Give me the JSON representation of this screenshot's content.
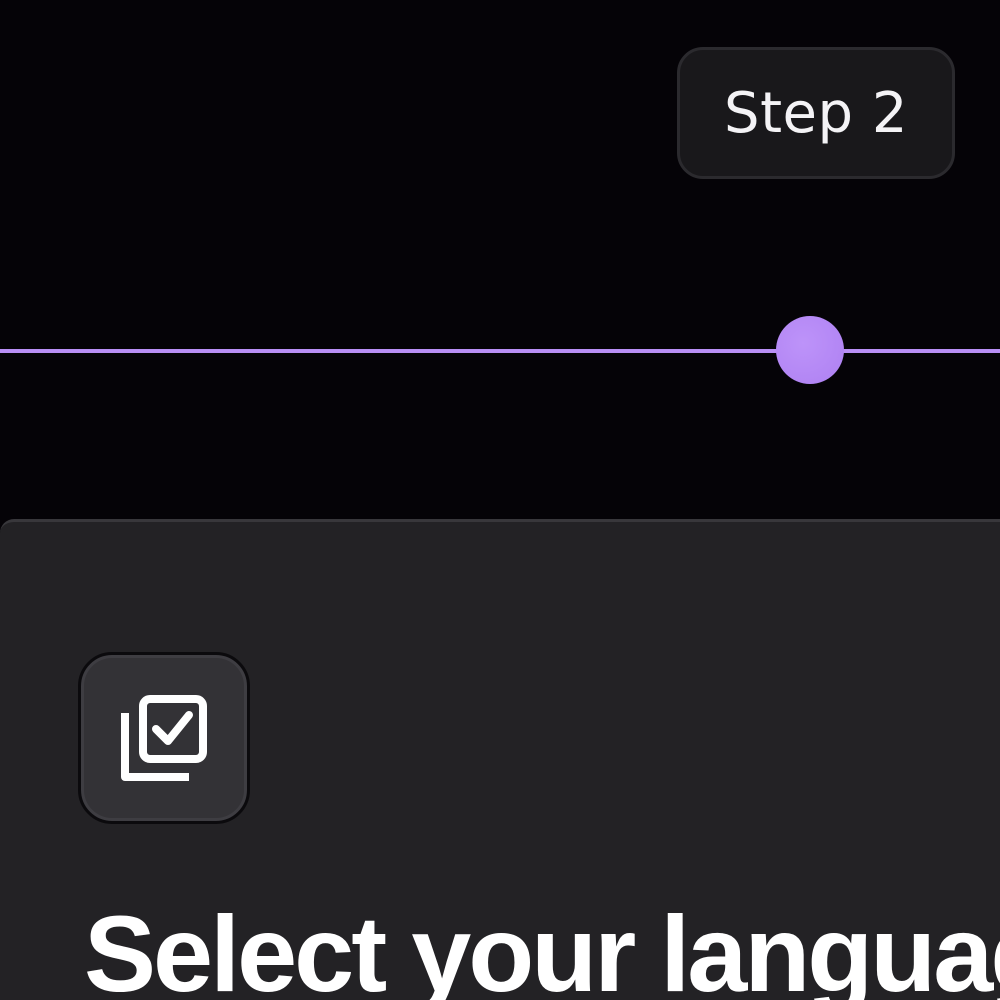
{
  "step_badge": {
    "label": "Step 2"
  },
  "progress": {
    "accent_color": "#b98ff5"
  },
  "panel": {
    "icon": "select-all-checkbox-icon",
    "title": "Select your language"
  }
}
